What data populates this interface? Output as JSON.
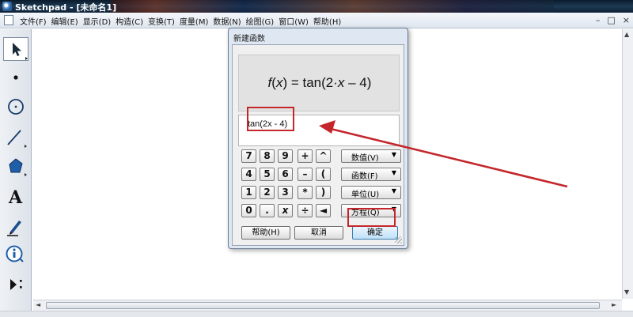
{
  "window": {
    "title": "Sketchpad - [未命名1]",
    "controls": [
      "–",
      "□",
      "×"
    ]
  },
  "menu": {
    "items": [
      "文件(F)",
      "编辑(E)",
      "显示(D)",
      "构造(C)",
      "变换(T)",
      "度量(M)",
      "数据(N)",
      "绘图(G)",
      "窗口(W)",
      "帮助(H)"
    ]
  },
  "toolbox": {
    "tools": [
      "select-arrow",
      "point",
      "compass",
      "straightedge",
      "polygon",
      "text",
      "marker",
      "information",
      "custom-tool"
    ],
    "text_tool_glyph": "A"
  },
  "dialog": {
    "title": "新建函数",
    "preview": {
      "f": "f",
      "x": "x",
      "prefix": "(",
      "mid": ") = tan(2·",
      "x2": "x",
      "suffix": " – 4)"
    },
    "expression": "tan(2x - 4)",
    "keypad": {
      "rows": [
        [
          "7",
          "8",
          "9",
          "+",
          "^"
        ],
        [
          "4",
          "5",
          "6",
          "–",
          "("
        ],
        [
          "1",
          "2",
          "3",
          "*",
          ")"
        ],
        [
          "0",
          ".",
          "x",
          "÷",
          "◄"
        ]
      ]
    },
    "dropdowns": [
      "数值(V)",
      "函数(F)",
      "单位(U)",
      "方程(Q)"
    ],
    "buttons": {
      "help": "帮助(H)",
      "cancel": "取消",
      "ok": "确定"
    }
  },
  "annotations": {
    "highlight_color": "#c4262b"
  }
}
